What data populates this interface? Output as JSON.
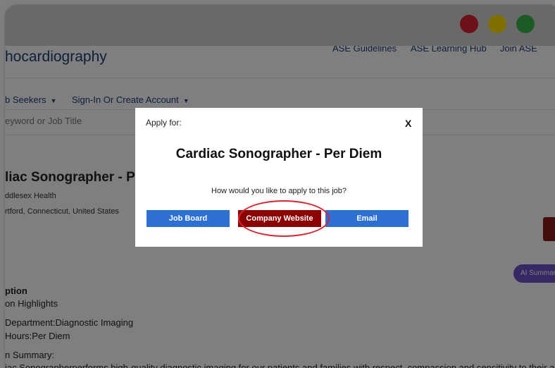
{
  "window": {
    "buttons": {
      "close_color": "#d9232f",
      "minimize_color": "#ffde00",
      "zoom_color": "#3bb54a"
    }
  },
  "header": {
    "brand": "hocardiography",
    "links": [
      "ASE Guidelines",
      "ASE Learning Hub",
      "Join ASE"
    ]
  },
  "nav": {
    "items": [
      "b Seekers",
      "Sign-In Or Create Account"
    ]
  },
  "search": {
    "placeholder": "eyword or Job Title"
  },
  "job": {
    "title": "liac Sonographer - Per",
    "employer": "ddlesex Health",
    "location": "rtford, Connecticut, United States"
  },
  "ai_summary_label": "AI Summary",
  "description": {
    "heading": "ption",
    "highlights": "on Highlights",
    "department": "Department:Diagnostic Imaging",
    "hours": "Hours:Per Diem",
    "summary_label": "n Summary:",
    "summary_text": "iac Sonographerperforms high-quality diagnostic imaging for our patients and families with respect, compassion and sensitivity to their age"
  },
  "modal": {
    "apply_for": "Apply for:",
    "close": "X",
    "job_title": "Cardiac Sonographer - Per Diem",
    "question": "How would you like to apply to this job?",
    "buttons": [
      "Job Board",
      "Company Website",
      "Email"
    ]
  },
  "colors": {
    "accent_blue": "#2e6fd4",
    "accent_red": "#8b0000",
    "brand_blue": "#1d3f78",
    "highlight_ring": "#d9232f"
  }
}
